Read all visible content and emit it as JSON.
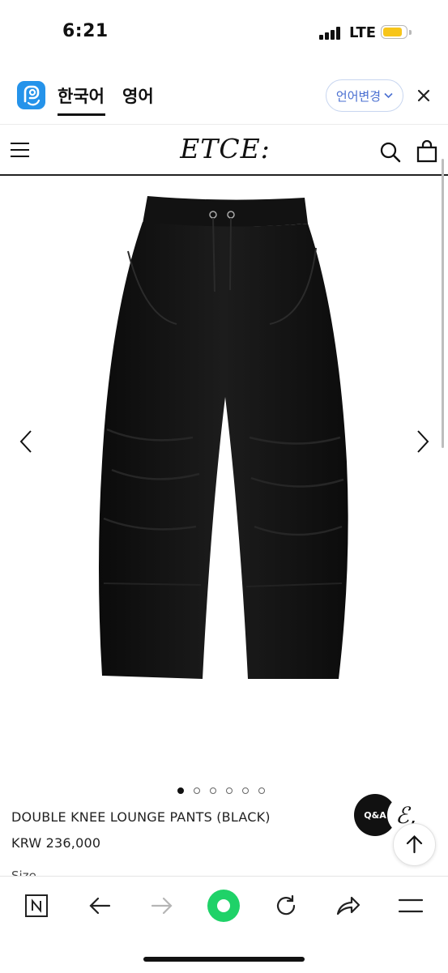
{
  "status_bar": {
    "time": "6:21",
    "network": "LTE",
    "battery_level": 0.85,
    "battery_color": "#f7c51a"
  },
  "translate_bar": {
    "tabs": [
      {
        "label": "한국어",
        "active": true
      },
      {
        "label": "영어",
        "active": false
      }
    ],
    "change_language_label": "언어변경",
    "close_icon": "close-icon",
    "accent_color": "#4a6fd1",
    "logo_color": "#2593ea"
  },
  "site": {
    "brand": "ETCE:",
    "icons": [
      "menu-icon",
      "search-icon",
      "shopping-bag-icon"
    ]
  },
  "gallery": {
    "total_images": 6,
    "current_index": 0
  },
  "product": {
    "name": "DOUBLE KNEE LOUNGE PANTS (BLACK)",
    "price": "KRW 236,000",
    "next_section_peek": "Size"
  },
  "floating": {
    "qa_label": "Q&A",
    "signature_text": "ℰ,"
  },
  "browser_toolbar": {
    "icons": [
      "naver-n-icon",
      "back-arrow-icon",
      "forward-arrow-icon",
      "green-dot-icon",
      "reload-icon",
      "share-icon",
      "menu-icon"
    ],
    "brand_green": "#1fd268"
  }
}
